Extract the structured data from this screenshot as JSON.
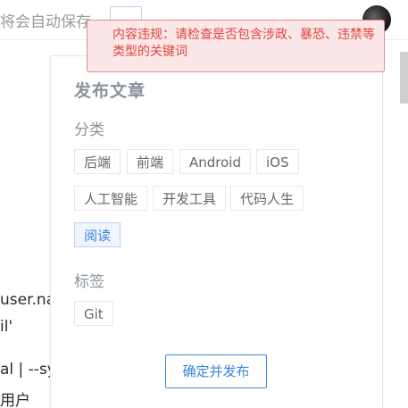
{
  "header": {
    "autosave_text": "将会自动保存",
    "avatar_label": "user avatar"
  },
  "editor": {
    "lines": [
      "user.na",
      "il'",
      "al | --sy",
      "用户"
    ]
  },
  "panel": {
    "title": "发布文章",
    "category_label": "分类",
    "categories": [
      "后端",
      "前端",
      "Android",
      "iOS",
      "人工智能",
      "开发工具",
      "代码人生",
      "阅读"
    ],
    "selected_category": "阅读",
    "tags_label": "标签",
    "tags": [
      "Git"
    ],
    "publish_label": "确定并发布"
  },
  "toast": {
    "message": "内容违规：请检查是否包含涉政、暴恐、违禁等类型的关键词"
  }
}
